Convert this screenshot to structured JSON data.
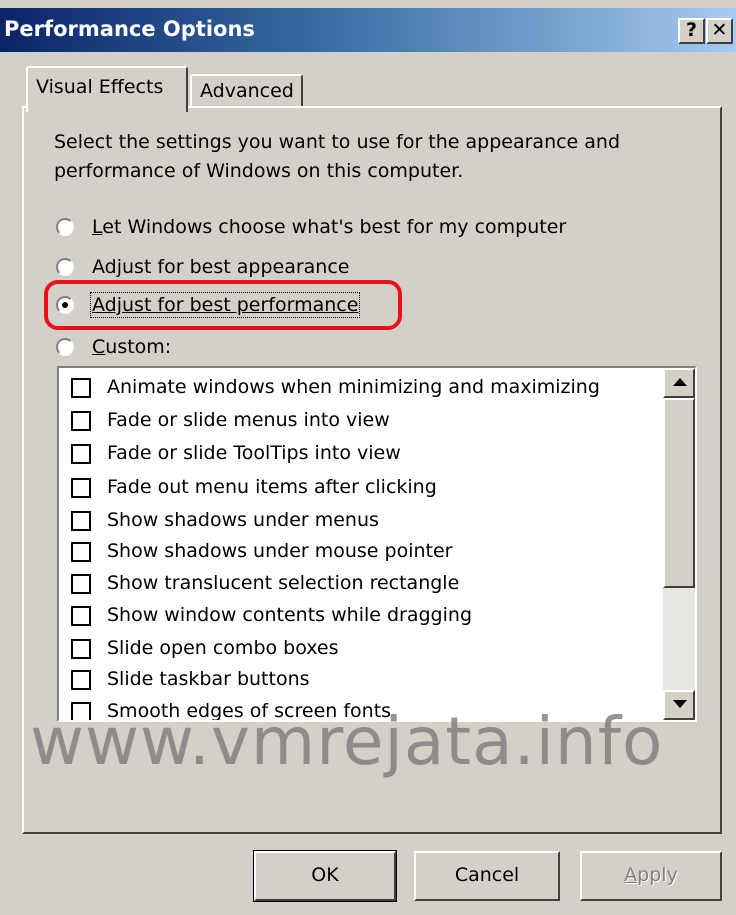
{
  "window": {
    "title": "Performance Options",
    "help_button": "?",
    "close_button": "✕",
    "title_gradient": [
      "#0a246a",
      "#a6caf0"
    ]
  },
  "tabs": [
    {
      "label": "Visual Effects",
      "selected": true
    },
    {
      "label": "Advanced",
      "selected": false
    }
  ],
  "description": "Select the settings you want to use for the appearance and performance of Windows on this computer.",
  "radios": [
    {
      "mnemonic": "L",
      "rest": "et Windows choose what's best for my computer",
      "checked": false
    },
    {
      "mnemonic": "",
      "rest": "Adjust for best appearance",
      "checked": false
    },
    {
      "mnemonic": "",
      "rest": "Adjust for best performance",
      "checked": true
    },
    {
      "mnemonic": "C",
      "rest": "ustom:",
      "checked": false
    }
  ],
  "visual_effects": [
    {
      "label": "Animate windows when minimizing and maximizing",
      "checked": false
    },
    {
      "label": "Fade or slide menus into view",
      "checked": false
    },
    {
      "label": "Fade or slide ToolTips into view",
      "checked": false
    },
    {
      "label": "Fade out menu items after clicking",
      "checked": false
    },
    {
      "label": "Show shadows under menus",
      "checked": false
    },
    {
      "label": "Show shadows under mouse pointer",
      "checked": false
    },
    {
      "label": "Show translucent selection rectangle",
      "checked": false
    },
    {
      "label": "Show window contents while dragging",
      "checked": false
    },
    {
      "label": "Slide open combo boxes",
      "checked": false
    },
    {
      "label": "Slide taskbar buttons",
      "checked": false
    },
    {
      "label": "Smooth edges of screen fonts",
      "checked": false
    }
  ],
  "highlight_color": "#e8101a",
  "watermark": "www.vmrejata.info",
  "buttons": {
    "ok": "OK",
    "cancel": "Cancel",
    "apply_mnemonic": "A",
    "apply_rest": "pply"
  }
}
